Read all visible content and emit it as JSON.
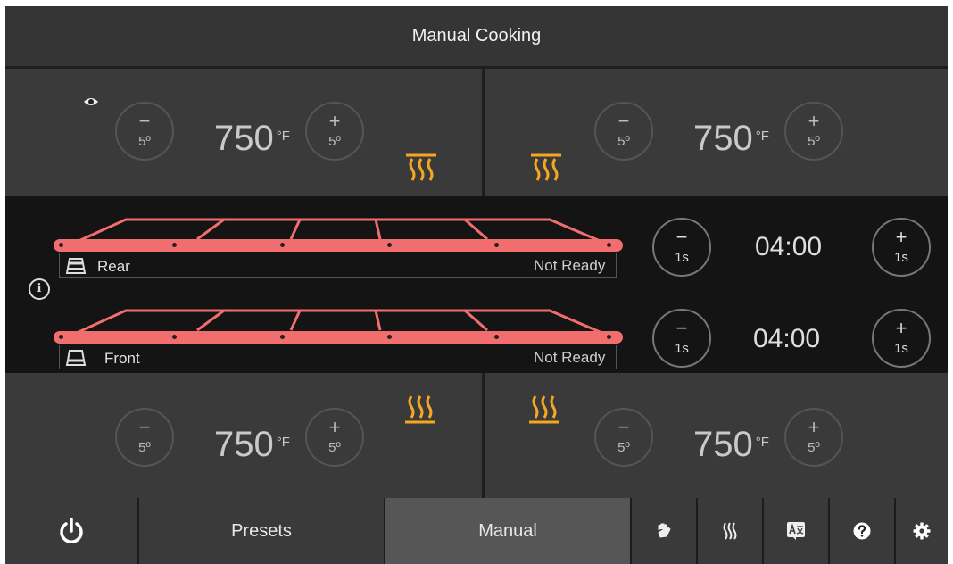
{
  "header": {
    "title": "Manual Cooking"
  },
  "zones": {
    "top_left": {
      "minus_symbol": "−",
      "minus_step": "5º",
      "plus_symbol": "+",
      "plus_step": "5º",
      "temperature": "750",
      "unit": "°F"
    },
    "top_right": {
      "minus_symbol": "−",
      "minus_step": "5º",
      "plus_symbol": "+",
      "plus_step": "5º",
      "temperature": "750",
      "unit": "°F"
    },
    "bottom_left": {
      "minus_symbol": "−",
      "minus_step": "5º",
      "plus_symbol": "+",
      "plus_step": "5º",
      "temperature": "750",
      "unit": "°F"
    },
    "bottom_right": {
      "minus_symbol": "−",
      "minus_step": "5º",
      "plus_symbol": "+",
      "plus_step": "5º",
      "temperature": "750",
      "unit": "°F"
    }
  },
  "conveyors": {
    "rear": {
      "label": "Rear",
      "status": "Not Ready",
      "time": "04:00",
      "minus_symbol": "−",
      "minus_step": "1s",
      "plus_symbol": "+",
      "plus_step": "1s"
    },
    "front": {
      "label": "Front",
      "status": "Not Ready",
      "time": "04:00",
      "minus_symbol": "−",
      "minus_step": "1s",
      "plus_symbol": "+",
      "plus_step": "1s"
    }
  },
  "info_icon": "i",
  "footer": {
    "presets_label": "Presets",
    "manual_label": "Manual",
    "active_tab": "Manual"
  },
  "icons": [
    "eye-icon",
    "heating-element-icon",
    "conveyor-icon",
    "info-icon",
    "power-icon",
    "cleaning-hand-icon",
    "steam-icon",
    "translate-icon",
    "help-icon",
    "gear-icon"
  ],
  "colors": {
    "heating": "#f5a623",
    "conveyor": "#f26d6d",
    "background": "#3a3a3a",
    "active_tab": "#565656"
  }
}
